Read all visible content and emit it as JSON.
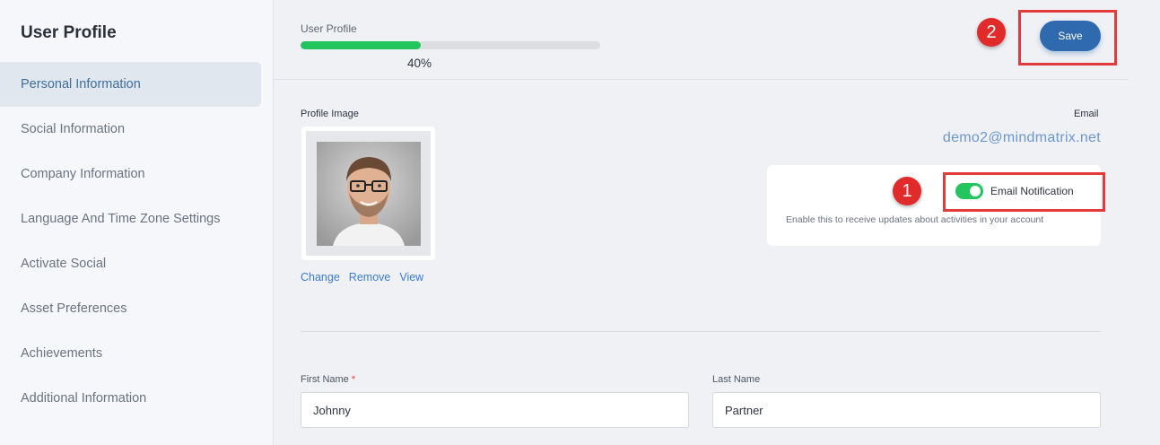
{
  "sidebar": {
    "title": "User Profile",
    "items": [
      {
        "label": "Personal Information",
        "active": true
      },
      {
        "label": "Social Information"
      },
      {
        "label": "Company Information"
      },
      {
        "label": "Language And Time Zone Settings"
      },
      {
        "label": "Activate Social"
      },
      {
        "label": "Asset Preferences"
      },
      {
        "label": "Achievements"
      },
      {
        "label": "Additional Information"
      }
    ]
  },
  "header": {
    "progress_label": "User Profile",
    "progress_value": 0.4,
    "progress_text": "40%",
    "save_label": "Save"
  },
  "profile_image": {
    "label": "Profile Image",
    "actions": {
      "change": "Change",
      "remove": "Remove",
      "view": "View"
    }
  },
  "email": {
    "label": "Email",
    "value": "demo2@mindmatrix.net"
  },
  "notification": {
    "title": "Email Notification",
    "description": "Enable this to receive updates about activities in your account",
    "enabled": true
  },
  "form": {
    "first_name": {
      "label": "First Name",
      "required_mark": "*",
      "value": "Johnny"
    },
    "last_name": {
      "label": "Last Name",
      "value": "Partner"
    }
  },
  "annotations": {
    "badge_1": "1",
    "badge_2": "2",
    "color": "#e33b3b"
  },
  "colors": {
    "accent": "#2f69ae",
    "toggle_on": "#22c55e",
    "link": "#3a7bd5"
  }
}
